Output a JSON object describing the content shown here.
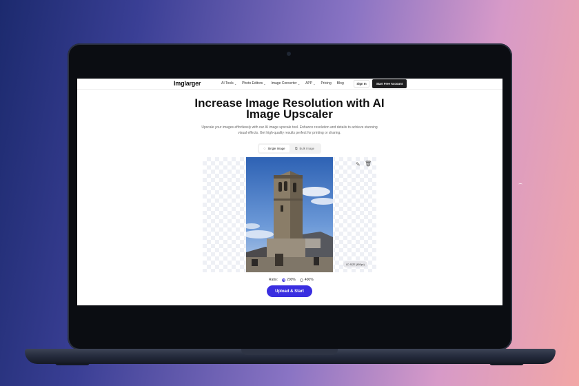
{
  "nav": {
    "logo": "Imglarger",
    "menu": [
      {
        "label": "AI Tools",
        "chevron": "⌄"
      },
      {
        "label": "Photo Editors",
        "chevron": "⌄"
      },
      {
        "label": "Image Converter",
        "chevron": "⌄"
      },
      {
        "label": "APP",
        "chevron": "⌄"
      },
      {
        "label": "Pricing"
      },
      {
        "label": "Blog"
      }
    ],
    "sign_in": "Sign In",
    "cta": "Start Free Account"
  },
  "hero": {
    "title": "Increase Image Resolution with AI Image Upscaler",
    "subtitle": "Upscale your images effortlessly with our AI image upscale tool. Enhance resolution and details to achieve stunning visual effects. Get high-quality results perfect for printing or sharing."
  },
  "tabs": [
    {
      "label": "Single Image",
      "icon": "image-icon",
      "active": true
    },
    {
      "label": "Bulk Image",
      "icon": "images-icon",
      "active": false
    }
  ],
  "preview": {
    "size_badge": "LD SIZE (800px)",
    "edit_icon": "pencil-icon",
    "delete_icon": "trash-icon"
  },
  "ratio": {
    "label": "Ratio:",
    "options": [
      {
        "label": "200%",
        "selected": true
      },
      {
        "label": "400%",
        "selected": false
      }
    ]
  },
  "upload_button": "Upload & Start",
  "colors": {
    "accent": "#3a2ee0",
    "cta_bg": "#1d1d1f"
  }
}
